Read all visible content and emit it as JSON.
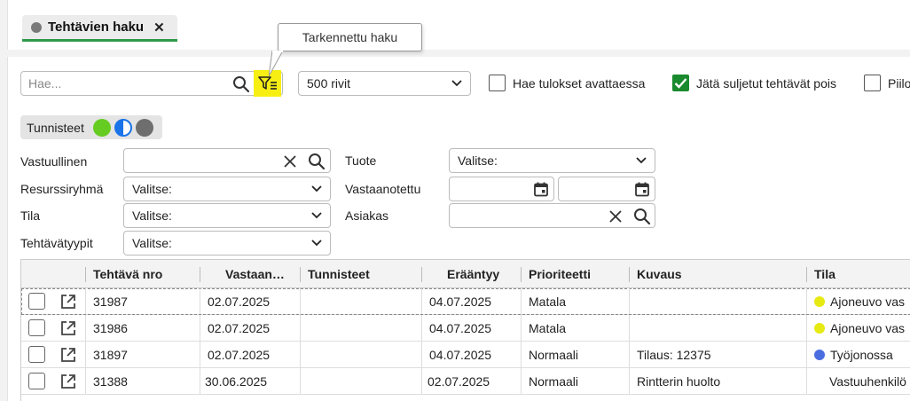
{
  "tab": {
    "label": "Tehtävien haku",
    "close": "✕"
  },
  "tooltip": {
    "text": "Tarkennettu haku"
  },
  "search": {
    "placeholder": "Hae...",
    "value": ""
  },
  "rows_select": {
    "value": "500 rivit"
  },
  "checks": [
    {
      "label": "Hae tulokset avattaessa",
      "checked": false
    },
    {
      "label": "Jätä suljetut tehtävät pois",
      "checked": true
    },
    {
      "label": "Piilot",
      "checked": false
    }
  ],
  "tags": {
    "label": "Tunnisteet",
    "colors": [
      "#66cc22",
      "#1a73e8",
      "#6e6e6e"
    ]
  },
  "filters": {
    "vastuullinen": {
      "label": "Vastuullinen",
      "value": ""
    },
    "resurssiryhma": {
      "label": "Resurssiryhmä",
      "value": "Valitse:"
    },
    "tila": {
      "label": "Tila",
      "value": "Valitse:"
    },
    "tehtavatyypit": {
      "label": "Tehtävätyypit",
      "value": "Valitse:"
    },
    "tuote": {
      "label": "Tuote",
      "value": "Valitse:"
    },
    "vastaanotettu": {
      "label": "Vastaanotettu",
      "from": "",
      "to": ""
    },
    "asiakas": {
      "label": "Asiakas",
      "value": ""
    }
  },
  "table": {
    "headers": [
      "Tehtävä nro",
      "Vastaan…",
      "Tunnisteet",
      "Erääntyy",
      "Prioriteetti",
      "Kuvaus",
      "Tila"
    ],
    "rows": [
      {
        "nro": "31987",
        "vastaan": "02.07.2025",
        "tunnisteet": "",
        "eraantyy": "04.07.2025",
        "prioriteetti": "Matala",
        "kuvaus": "",
        "tila": "Ajoneuvo vas",
        "dot": "#e6ea12"
      },
      {
        "nro": "31986",
        "vastaan": "02.07.2025",
        "tunnisteet": "",
        "eraantyy": "04.07.2025",
        "prioriteetti": "Matala",
        "kuvaus": "",
        "tila": "Ajoneuvo vas",
        "dot": "#e6ea12"
      },
      {
        "nro": "31897",
        "vastaan": "02.07.2025",
        "tunnisteet": "",
        "eraantyy": "04.07.2025",
        "prioriteetti": "Normaali",
        "kuvaus": "Tilaus: 12375",
        "tila": "Työjonossa",
        "dot": "#4a6ee0"
      },
      {
        "nro": "31388",
        "vastaan": "30.06.2025",
        "tunnisteet": "",
        "eraantyy": "02.07.2025",
        "prioriteetti": "Normaali",
        "kuvaus": "Rintterin huolto",
        "tila": "Vastuuhenkilö",
        "dot": ""
      }
    ]
  },
  "colors": {
    "accent": "#2f9a4a",
    "highlight": "#f7ef14",
    "checked": "#1a8a2e"
  }
}
